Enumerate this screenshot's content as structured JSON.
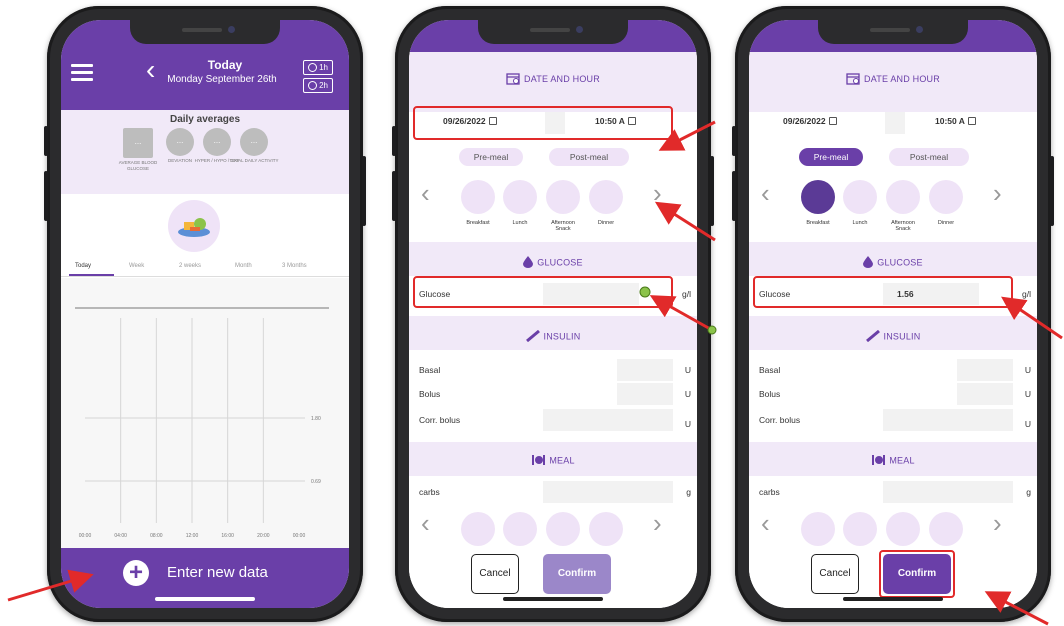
{
  "colors": {
    "purple": "#6a3fa8",
    "light_purple": "#f1e9f8",
    "highlight_red": "#e12a2a"
  },
  "screen1": {
    "header": {
      "title": "Today",
      "date": "Monday September 26th",
      "timer_buttons": [
        "1h",
        "2h"
      ]
    },
    "averages": {
      "title": "Daily averages",
      "items": [
        {
          "value": "...",
          "label": "AVERAGE BLOOD GLUCOSE"
        },
        {
          "value": "...",
          "label": "DEVIATION"
        },
        {
          "value": "...",
          "label": "HYPER / HYPO / DAY"
        },
        {
          "value": "...",
          "label": "TOTAL DAILY ACTIVITY"
        }
      ]
    },
    "tabs": [
      "Today",
      "Week",
      "2 weeks",
      "Month",
      "3 Months"
    ],
    "chart_data": {
      "type": "line",
      "x_ticks": [
        "00:00",
        "04:00",
        "08:00",
        "12:00",
        "16:00",
        "20:00",
        "00:00"
      ],
      "y_ticks": [
        "1.80",
        "0.69"
      ],
      "series": []
    },
    "footer": {
      "label": "Enter new data"
    }
  },
  "form": {
    "date_section": "DATE AND HOUR",
    "date": "09/26/2022",
    "time_p2": "10:50 A",
    "time_p3": "10:50 A",
    "pre_meal": "Pre-meal",
    "post_meal": "Post-meal",
    "meals": [
      {
        "label": "Breakfast",
        "icon": "breakfast-icon"
      },
      {
        "label": "Lunch",
        "icon": "lunch-icon"
      },
      {
        "label": "Afternoon Snack",
        "icon": "snack-icon"
      },
      {
        "label": "Dinner",
        "icon": "dinner-icon"
      }
    ],
    "glucose_section": "GLUCOSE",
    "glucose_label": "Glucose",
    "glucose_unit": "g/l",
    "glucose_value_p3": "1.56",
    "insulin_section": "INSULIN",
    "basal_label": "Basal",
    "bolus_label": "Bolus",
    "corr_bolus_label": "Corr. bolus",
    "insulin_unit": "U",
    "meal_section": "MEAL",
    "carbs_label": "carbs",
    "carbs_unit": "g",
    "cancel": "Cancel",
    "confirm": "Confirm"
  }
}
